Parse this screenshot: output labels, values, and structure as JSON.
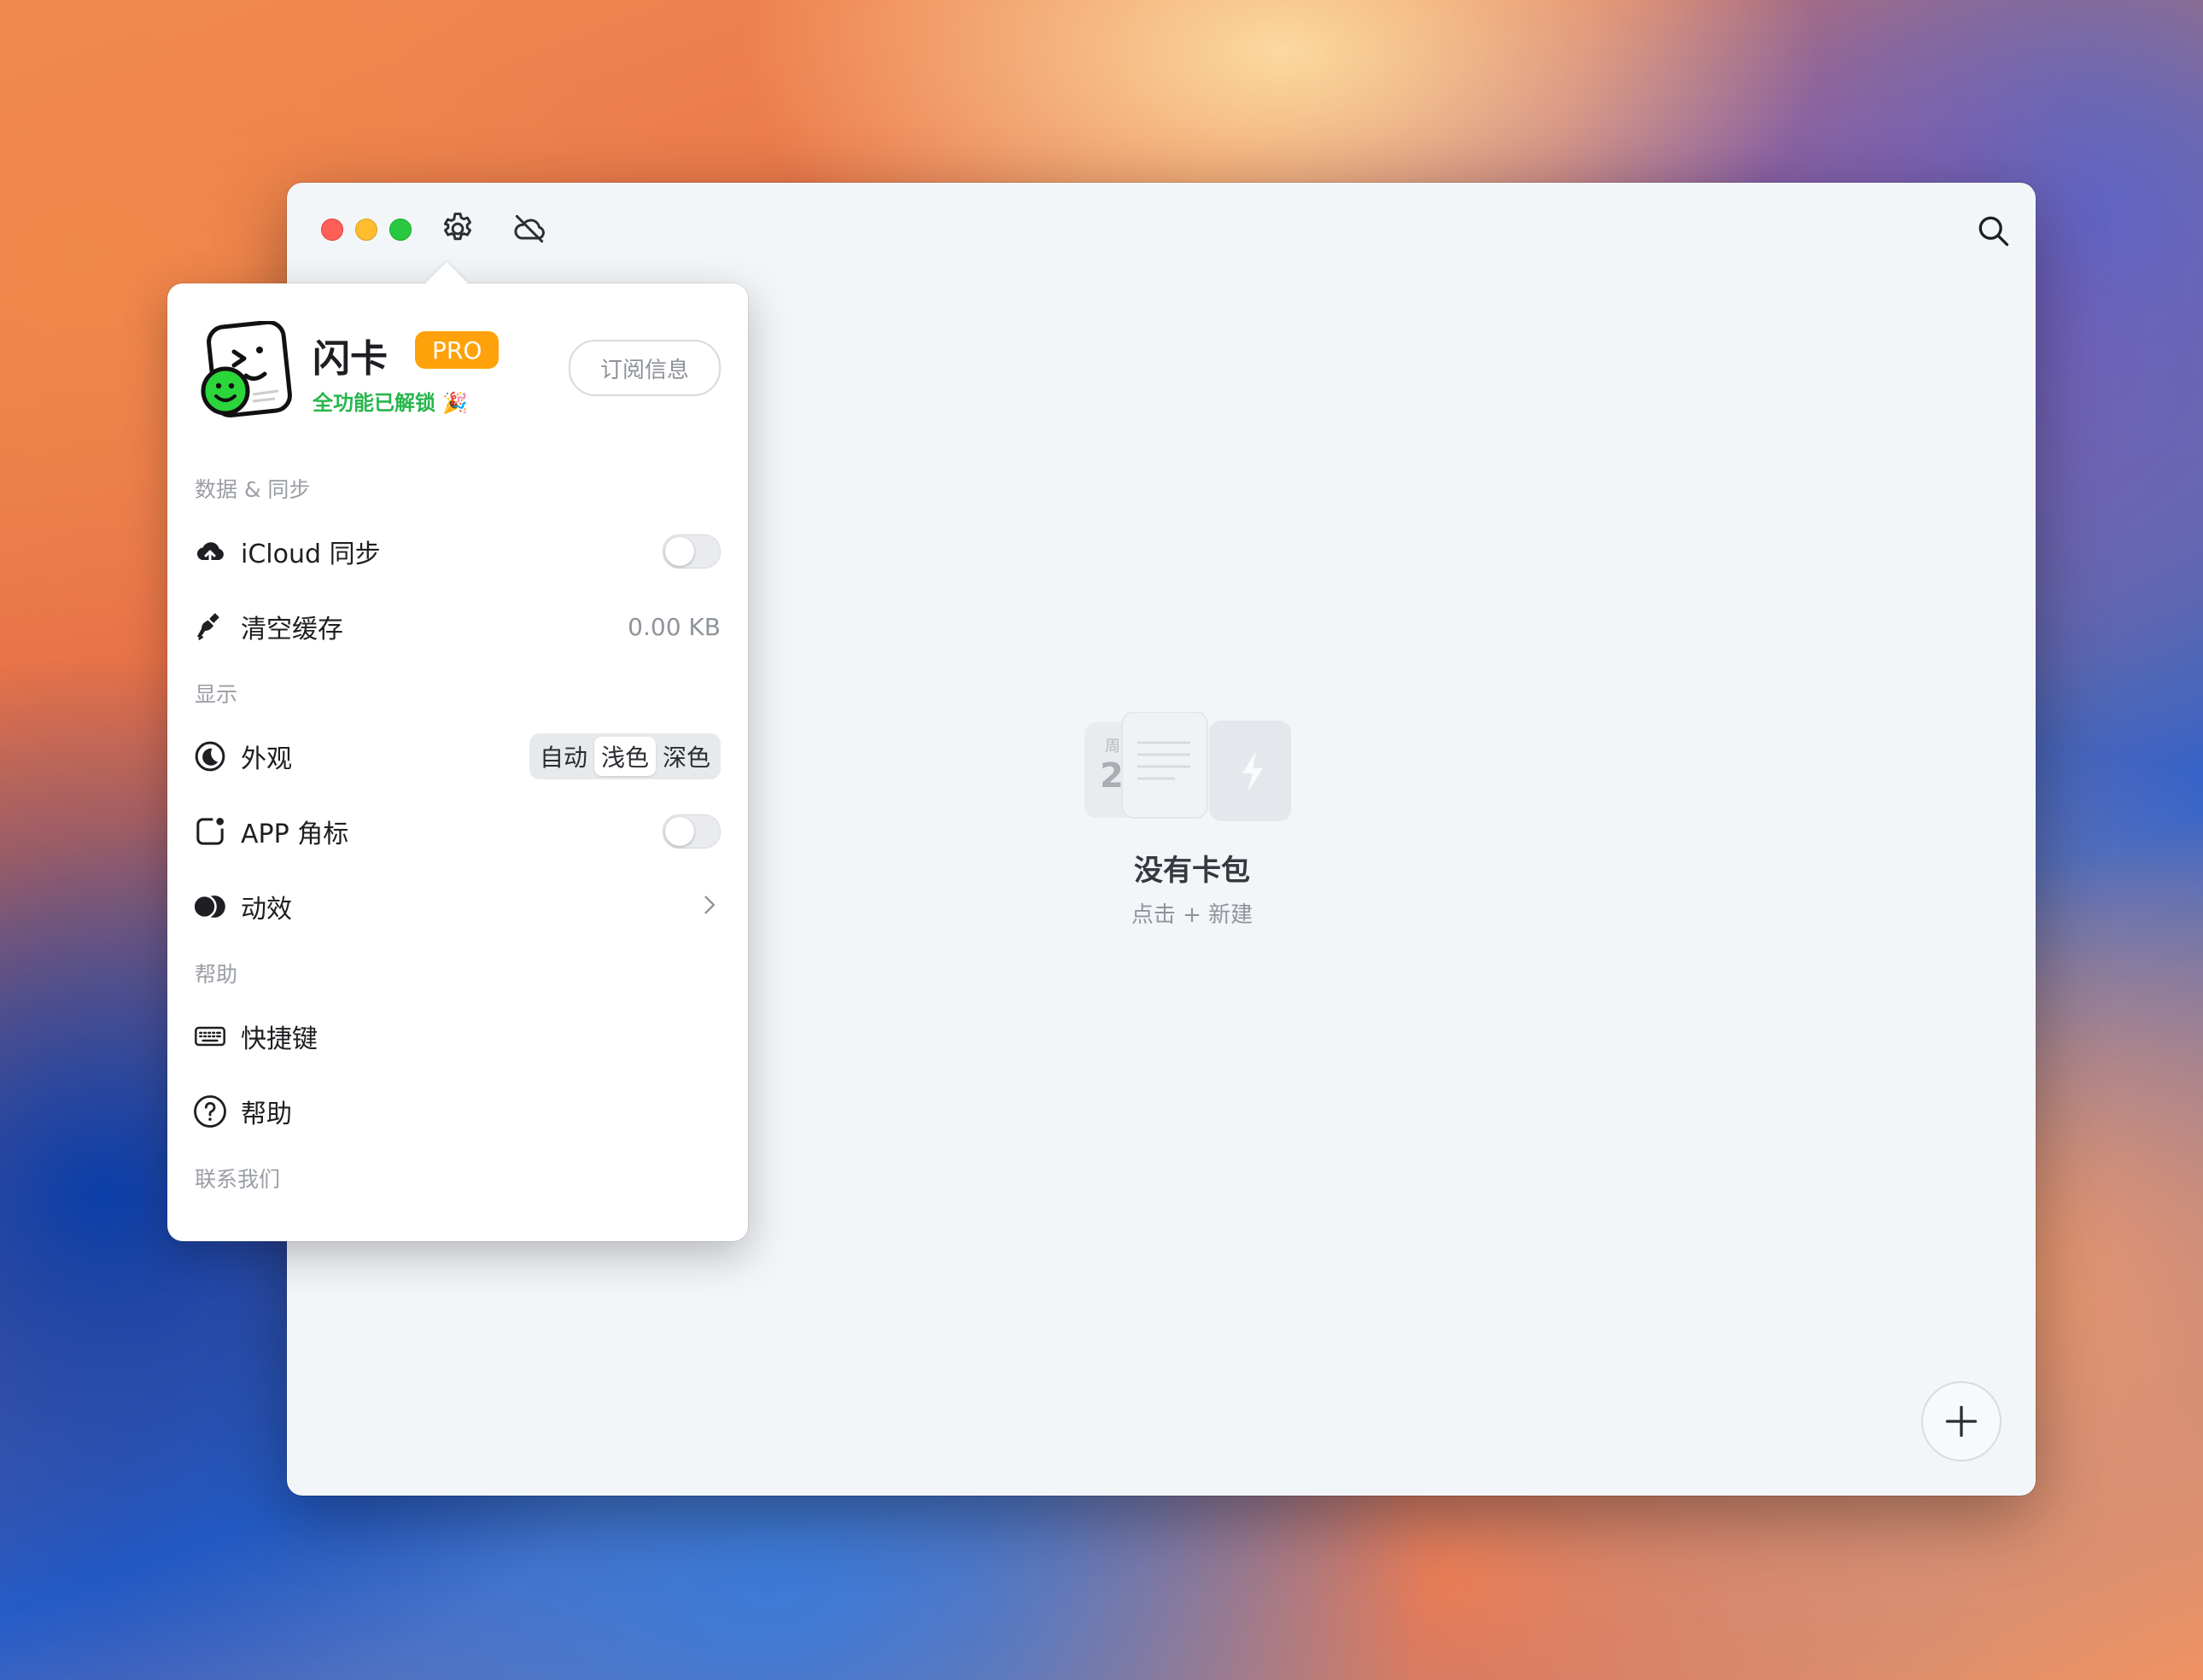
{
  "window": {
    "empty_state": {
      "title": "没有卡包",
      "subtitle": "点击 + 新建",
      "art_date_top": "周",
      "art_date_num": "2"
    },
    "icons": {
      "settings": "gear-icon",
      "cloud_off": "cloud-off-icon",
      "search": "search-icon",
      "add": "plus-icon"
    }
  },
  "popover": {
    "app_name": "闪卡",
    "pro_badge": "PRO",
    "unlock_text": "全功能已解锁 🎉",
    "subscription_button": "订阅信息",
    "sections": {
      "data_sync": "数据 & 同步",
      "display": "显示",
      "help": "帮助",
      "contact": "联系我们"
    },
    "rows": {
      "icloud": {
        "label": "iCloud 同步",
        "enabled": false
      },
      "clear_cache": {
        "label": "清空缓存",
        "value": "0.00 KB"
      },
      "appearance": {
        "label": "外观",
        "options": [
          "自动",
          "浅色",
          "深色"
        ],
        "selected": "浅色"
      },
      "app_badge": {
        "label": "APP 角标",
        "enabled": false
      },
      "animation": {
        "label": "动效"
      },
      "shortcuts": {
        "label": "快捷键"
      },
      "help": {
        "label": "帮助"
      }
    }
  },
  "colors": {
    "pro_badge": "#ffa10a",
    "unlock_green": "#27b64d",
    "close": "#ff5f57",
    "minimize": "#febc2e",
    "maximize": "#28c840"
  }
}
